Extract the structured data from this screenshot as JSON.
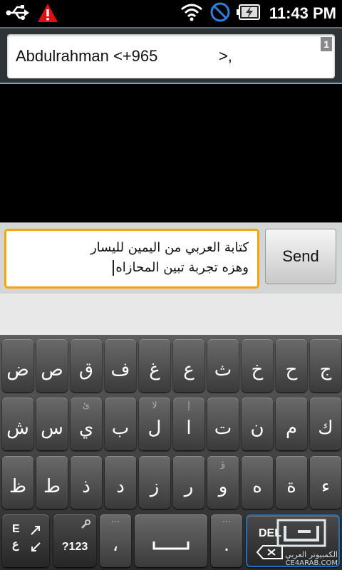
{
  "status_bar": {
    "time": "11:43 PM",
    "icons": [
      "usb-icon",
      "warning-icon",
      "wifi-icon",
      "blocked-icon",
      "battery-charging-icon"
    ]
  },
  "recipient": {
    "text": "Abdulrahman <+965              >,",
    "count": "1"
  },
  "compose": {
    "line1": "كتابة العربي من اليمين لليسار",
    "line2": "وهزه تجربة تبين المحازاه",
    "send_label": "Send"
  },
  "keyboard": {
    "row1": [
      {
        "main": "ض",
        "hint": ""
      },
      {
        "main": "ص",
        "hint": ""
      },
      {
        "main": "ق",
        "hint": ""
      },
      {
        "main": "ف",
        "hint": ""
      },
      {
        "main": "غ",
        "hint": ""
      },
      {
        "main": "ع",
        "hint": ""
      },
      {
        "main": "ث",
        "hint": ""
      },
      {
        "main": "خ",
        "hint": ""
      },
      {
        "main": "ح",
        "hint": ""
      },
      {
        "main": "ج",
        "hint": ""
      }
    ],
    "row2": [
      {
        "main": "ش",
        "hint": ""
      },
      {
        "main": "س",
        "hint": ""
      },
      {
        "main": "ي",
        "hint": "ئ"
      },
      {
        "main": "ب",
        "hint": ""
      },
      {
        "main": "ل",
        "hint": "لا"
      },
      {
        "main": "ا",
        "hint": "إ"
      },
      {
        "main": "ت",
        "hint": ""
      },
      {
        "main": "ن",
        "hint": ""
      },
      {
        "main": "م",
        "hint": ""
      },
      {
        "main": "ك",
        "hint": ""
      }
    ],
    "row3": [
      {
        "main": "ظ",
        "hint": ""
      },
      {
        "main": "ط",
        "hint": ""
      },
      {
        "main": "ذ",
        "hint": ""
      },
      {
        "main": "د",
        "hint": ""
      },
      {
        "main": "ز",
        "hint": ""
      },
      {
        "main": "ر",
        "hint": ""
      },
      {
        "main": "و",
        "hint": "ؤ"
      },
      {
        "main": "ه",
        "hint": ""
      },
      {
        "main": "ة",
        "hint": ""
      },
      {
        "main": "ء",
        "hint": ""
      }
    ],
    "bottom": {
      "lang_top": "E",
      "lang_bottom": "ع",
      "symbols": "?123",
      "comma": "،",
      "period": ".",
      "delete": "DEL"
    }
  },
  "watermark": {
    "line1": "الكمبيوتر العربي",
    "line2": "CE4ARAB.COM"
  }
}
